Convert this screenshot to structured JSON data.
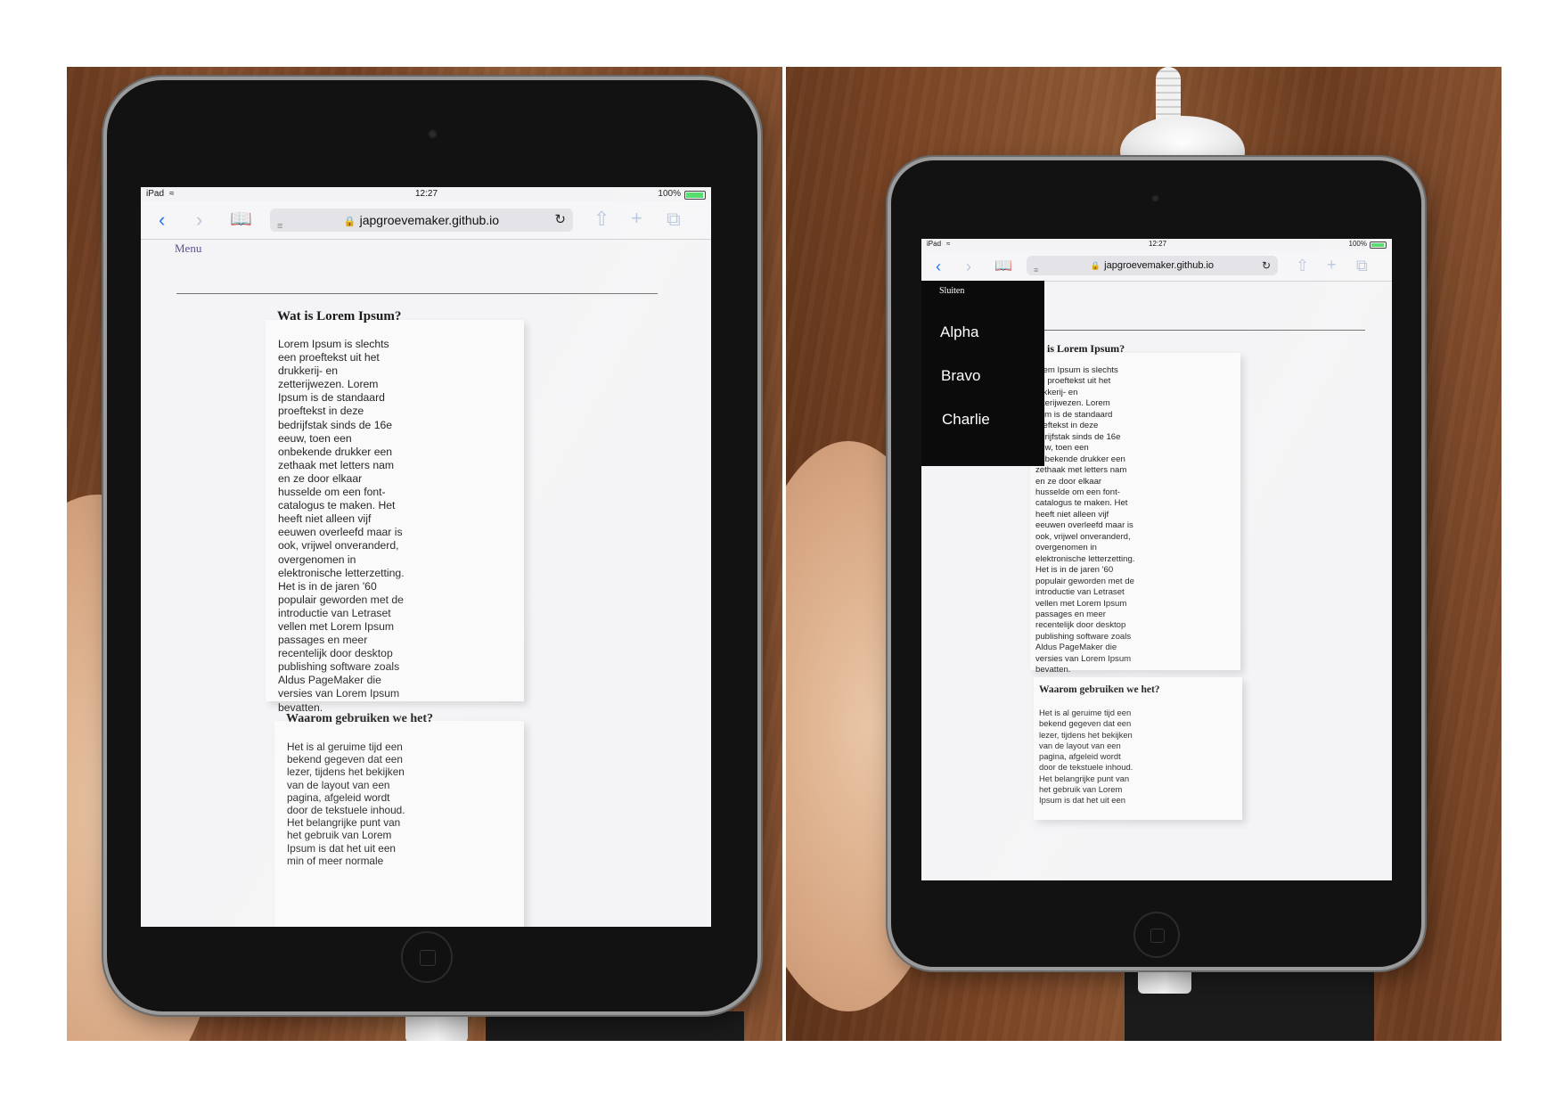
{
  "left_photo": {
    "status": {
      "carrier": "iPad",
      "time": "12:27",
      "battery": "100%"
    },
    "browser": {
      "url": "japgroevemaker.github.io"
    },
    "page": {
      "menu_label": "Menu",
      "sections": [
        {
          "heading": "Wat is Lorem Ipsum?",
          "body": "Lorem Ipsum is slechts\neen proeftekst uit het\ndrukkerij- en\nzetterijwezen. Lorem\nIpsum is de standaard\nproeftekst in deze\nbedrijfstak sinds de 16e\neeuw, toen een\nonbekende drukker een\nzethaak met letters nam\nen ze door elkaar\nhusselde om een font-\ncatalogus te maken. Het\nheeft niet alleen vijf\neeuwen overleefd maar is\nook, vrijwel onveranderd,\novergenomen in\nelektronische letterzetting.\nHet is in de jaren '60\npopulair geworden met de\nintroductie van Letraset\nvellen met Lorem Ipsum\npassages en meer\nrecentelijk door desktop\npublishing software zoals\nAldus PageMaker die\nversies van Lorem Ipsum\nbevatten."
        },
        {
          "heading": "Waarom gebruiken we het?",
          "body": "Het is al geruime tijd een\nbekend gegeven dat een\nlezer, tijdens het bekijken\nvan de layout van een\npagina, afgeleid wordt\ndoor de tekstuele inhoud.\nHet belangrijke punt van\nhet gebruik van Lorem\nIpsum is dat het uit een\nmin of meer normale"
        }
      ]
    }
  },
  "right_photo": {
    "status": {
      "carrier": "iPad",
      "time": "12:27",
      "battery": "100%"
    },
    "browser": {
      "url": "japgroevemaker.github.io"
    },
    "drawer": {
      "close_label": "Sluiten",
      "items": [
        "Alpha",
        "Bravo",
        "Charlie"
      ]
    },
    "page": {
      "sections": [
        {
          "heading": "at is Lorem Ipsum?",
          "body": "orem Ipsum is slechts\nen proeftekst uit het\nrukkerij- en\netterijwezen. Lorem\nsum is de standaard\nroeftekst in deze\nedrijfstak sinds de 16e\neuw, toen een\nonbekende drukker een\nzethaak met letters nam\nen ze door elkaar\nhusselde om een font-\ncatalogus te maken. Het\nheeft niet alleen vijf\neeuwen overleefd maar is\nook, vrijwel onveranderd,\novergenomen in\nelektronische letterzetting.\nHet is in de jaren '60\npopulair geworden met de\nintroductie van Letraset\nvellen met Lorem Ipsum\npassages en meer\nrecentelijk door desktop\npublishing software zoals\nAldus PageMaker die\nversies van Lorem Ipsum\nbevatten."
        },
        {
          "heading": "Waarom gebruiken we het?",
          "body": "Het is al geruime tijd een\nbekend gegeven dat een\nlezer, tijdens het bekijken\nvan de layout van een\npagina, afgeleid wordt\ndoor de tekstuele inhoud.\nHet belangrijke punt van\nhet gebruik van Lorem\nIpsum is dat het uit een"
        }
      ]
    }
  },
  "icons": {
    "back": "chevron-left-icon",
    "forward": "chevron-right-icon",
    "bookmarks": "book-icon",
    "reader": "reader-icon",
    "lock": "lock-icon",
    "reload": "reload-icon",
    "share": "share-icon",
    "new_tab": "plus-icon",
    "tabs": "tabs-icon",
    "wifi": "wifi-icon"
  },
  "colors": {
    "safari_blue": "#1e7bf2",
    "menu_link": "#5c4f8c",
    "drawer_bg": "#0b0b0b",
    "battery_green": "#4cd964"
  }
}
